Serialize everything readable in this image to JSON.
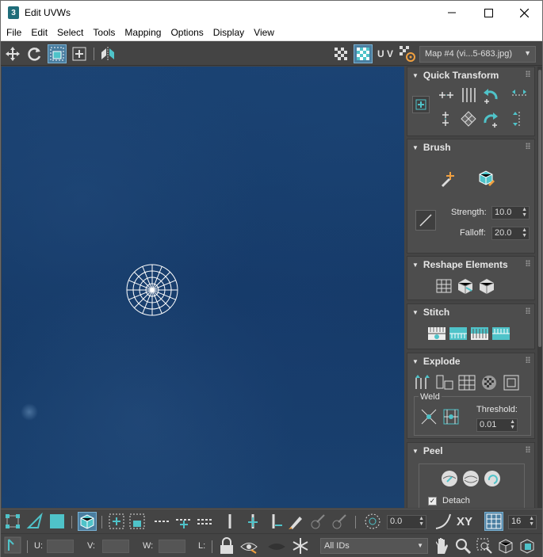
{
  "window": {
    "title": "Edit UVWs",
    "app_icon": "3",
    "controls": [
      "minimize-icon",
      "maximize-icon",
      "close-icon"
    ]
  },
  "menubar": {
    "items": [
      "File",
      "Edit",
      "Select",
      "Tools",
      "Mapping",
      "Options",
      "Display",
      "View"
    ]
  },
  "toolbar": {
    "uv_label": "U V",
    "map_selector": "Map #4 (vi...5-683.jpg)"
  },
  "panel": {
    "quick_transform": {
      "title": "Quick Transform"
    },
    "brush": {
      "title": "Brush",
      "strength_label": "Strength:",
      "strength_value": "10.0",
      "falloff_label": "Falloff:",
      "falloff_value": "20.0"
    },
    "reshape": {
      "title": "Reshape Elements"
    },
    "stitch": {
      "title": "Stitch"
    },
    "explode": {
      "title": "Explode",
      "weld_label": "Weld",
      "threshold_label": "Threshold:",
      "threshold_value": "0.01"
    },
    "peel": {
      "title": "Peel",
      "detach_label": "Detach",
      "detach_checked": true
    }
  },
  "bottom_bar": {
    "angle_value": "0.0",
    "xy_label": "XY",
    "grid_value": "16"
  },
  "status_bar": {
    "u_label": "U:",
    "v_label": "V:",
    "w_label": "W:",
    "l_label": "L:",
    "id_filter": "All IDs"
  },
  "colors": {
    "accent": "#4fc3c9",
    "viewport_bg": "#163c6a",
    "panel_bg": "#444444"
  }
}
